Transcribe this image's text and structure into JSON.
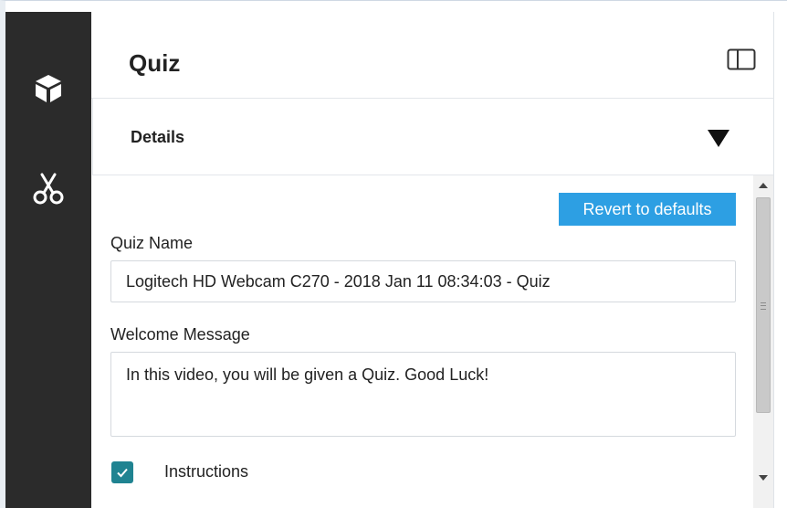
{
  "panel": {
    "title": "Quiz"
  },
  "details": {
    "label": "Details"
  },
  "toolbar": {
    "revert_label": "Revert to defaults"
  },
  "form": {
    "quiz_name": {
      "label": "Quiz Name",
      "value": "Logitech HD Webcam C270 - 2018 Jan 11 08:34:03 - Quiz"
    },
    "welcome_message": {
      "label": "Welcome Message",
      "value": "In this video, you will be given a Quiz. Good Luck!"
    },
    "instructions": {
      "label": "Instructions",
      "checked": true
    }
  },
  "icons": {
    "rail": [
      "cube-icon",
      "scissors-icon"
    ],
    "header": "panel-toggle-icon",
    "details": "caret-down-icon"
  },
  "colors": {
    "rail_bg": "#2b2b2b",
    "accent_button": "#2d9fe3",
    "checkbox": "#1f8391"
  }
}
